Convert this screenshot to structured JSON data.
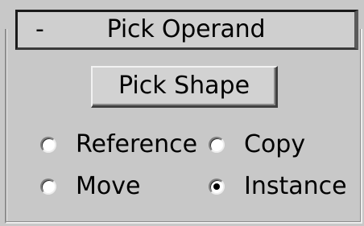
{
  "rollout": {
    "collapse_symbol": "-",
    "title": "Pick Operand"
  },
  "pick_button": {
    "label": "Pick Shape"
  },
  "options": {
    "reference": {
      "label": "Reference",
      "checked": false
    },
    "copy": {
      "label": "Copy",
      "checked": false
    },
    "move": {
      "label": "Move",
      "checked": false
    },
    "instance": {
      "label": "Instance",
      "checked": true
    }
  }
}
